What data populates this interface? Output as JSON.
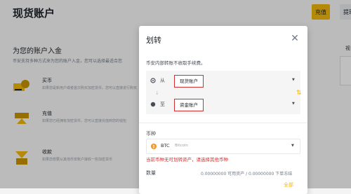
{
  "page": {
    "title": "现货账户",
    "deposit_label": "充值",
    "withdraw_label": "提现"
  },
  "background": {
    "section_title": "为您的账户入金",
    "section_desc": "币安支持多种方式来为您的账户入金，您可以选择最适合您",
    "items": [
      {
        "title": "买币",
        "desc": "如果您是新用户或者首次购买加密货币，您可以直接进行购买"
      },
      {
        "title": "充值",
        "desc": "如果您已经拥有加密货币，您可以直接充值到您的钱包"
      },
      {
        "title": "收款",
        "desc": "如果您想要从其他币安账户接收一些加密货币"
      }
    ],
    "side_label": "视"
  },
  "modal": {
    "title": "划转",
    "close_icon": "close-icon",
    "notice": "币安内部转账不收取手续费。",
    "from_label": "从",
    "from_value": "现货账户",
    "to_label": "至",
    "to_value": "资金账户",
    "coin_label": "币种",
    "coin_symbol": "BTC",
    "coin_name": "Bitcoin",
    "error": "当前币种无可划转资产，请选择其他币种",
    "qty_label": "数量",
    "qty_info": "0.00000000 可用资产 / 0.00000000 下单冻结",
    "all_label": "全部"
  },
  "colors": {
    "accent": "#f0b90b",
    "error": "#d0302f",
    "btc": "#f7931a"
  }
}
